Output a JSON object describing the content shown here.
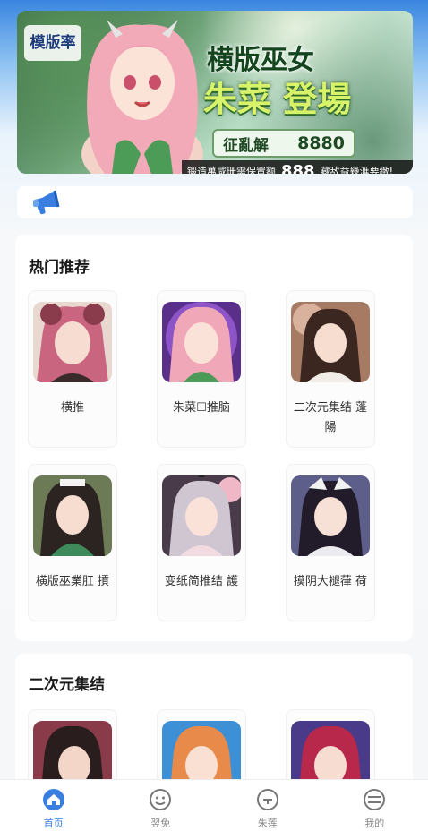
{
  "banner": {
    "logo_text": "模版率",
    "title_line1": "横版巫女",
    "title_line2": "朱菜 登場",
    "code_label": "征亂解",
    "code_value": "8880",
    "strip_left": "锻造萬咸珊需保置额",
    "strip_number": "888",
    "strip_right": "藏敌益幾滙要緻!"
  },
  "notice": {
    "icon": "megaphone-icon",
    "text": ""
  },
  "hot_section": {
    "title": "热门推荐",
    "games": [
      {
        "label": "横推"
      },
      {
        "label": "朱菜☐推脑"
      },
      {
        "label": "二次元集结 蓬陽"
      },
      {
        "label": "横版巫業肛 摃"
      },
      {
        "label": "变纸简推结 護"
      },
      {
        "label": "摸阴大褪葎 荷"
      }
    ]
  },
  "collection_section": {
    "title": "二次元集结",
    "games": [
      {
        "label": ""
      },
      {
        "label": ""
      },
      {
        "label": ""
      }
    ]
  },
  "tabbar": {
    "items": [
      {
        "label": "首页",
        "icon": "home-icon",
        "active": true
      },
      {
        "label": "翌免",
        "icon": "face-icon",
        "active": false
      },
      {
        "label": "朱莲",
        "icon": "chat-icon",
        "active": false
      },
      {
        "label": "我的",
        "icon": "user-icon",
        "active": false
      }
    ],
    "active_color": "#3a7fe0",
    "inactive_color": "#888888"
  }
}
